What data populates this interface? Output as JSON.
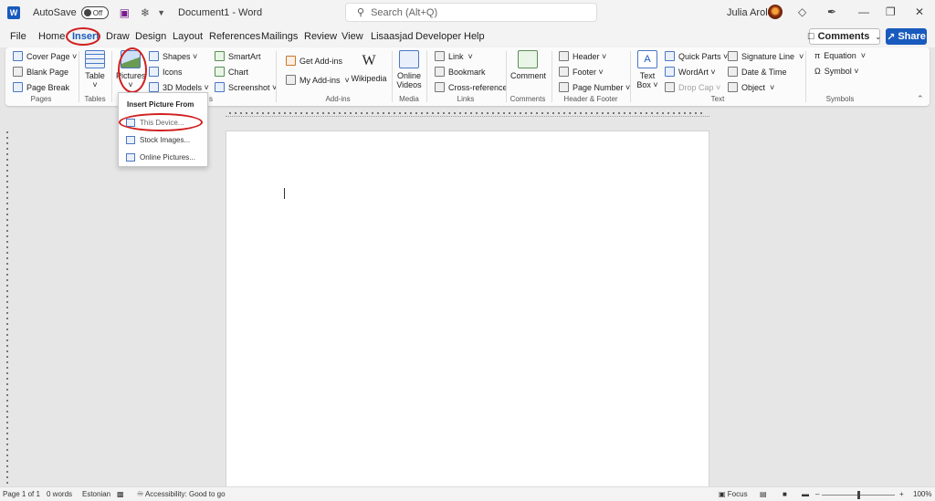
{
  "titlebar": {
    "app_icon": "W",
    "autosave_label": "AutoSave",
    "autosave_state": "Off",
    "doc_title": "Document1 - Word",
    "search_placeholder": "Search (Alt+Q)",
    "user_name": "Julia Arold"
  },
  "menu": {
    "tabs": [
      "File",
      "Home",
      "Insert",
      "Draw",
      "Design",
      "Layout",
      "References",
      "Mailings",
      "Review",
      "View",
      "Lisaasjad",
      "Developer",
      "Help"
    ],
    "active_tab": "Insert",
    "comments_label": "Comments",
    "share_label": "Share"
  },
  "ribbon": {
    "pages": {
      "cover_page": "Cover Page",
      "blank_page": "Blank Page",
      "page_break": "Page Break",
      "label": "Pages"
    },
    "tables": {
      "table": "Table",
      "label": "Tables"
    },
    "illustrations": {
      "pictures": "Pictures",
      "shapes": "Shapes",
      "icons": "Icons",
      "models": "3D Models",
      "smartart": "SmartArt",
      "chart": "Chart",
      "screenshot": "Screenshot",
      "label_tail": "s"
    },
    "addins": {
      "get_addins": "Get Add-ins",
      "my_addins": "My Add-ins",
      "wikipedia": "Wikipedia",
      "label": "Add-ins"
    },
    "media": {
      "online_videos_1": "Online",
      "online_videos_2": "Videos",
      "label": "Media"
    },
    "links": {
      "link": "Link",
      "bookmark": "Bookmark",
      "cross_reference": "Cross-reference",
      "label": "Links"
    },
    "comments": {
      "comment": "Comment",
      "label": "Comments"
    },
    "header_footer": {
      "header": "Header",
      "footer": "Footer",
      "page_number": "Page Number",
      "label": "Header & Footer"
    },
    "text": {
      "text_box_1": "Text",
      "text_box_2": "Box",
      "quick_parts": "Quick Parts",
      "wordart": "WordArt",
      "drop_cap": "Drop Cap",
      "signature_line": "Signature Line",
      "date_time": "Date & Time",
      "object": "Object",
      "label": "Text"
    },
    "symbols": {
      "equation": "Equation",
      "symbol": "Symbol",
      "label": "Symbols"
    }
  },
  "dropdown": {
    "header": "Insert Picture From",
    "items": [
      "This Device...",
      "Stock Images...",
      "Online Pictures..."
    ]
  },
  "status": {
    "page": "Page 1 of 1",
    "words": "0 words",
    "language": "Estonian",
    "accessibility": "Accessibility: Good to go",
    "focus": "Focus",
    "zoom": "100%"
  },
  "colors": {
    "accent": "#185abd",
    "annotation": "#d21f1f"
  }
}
